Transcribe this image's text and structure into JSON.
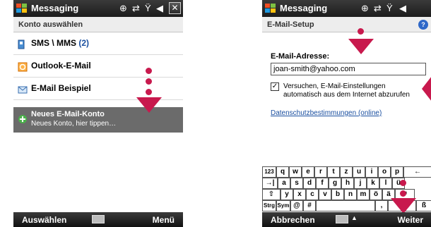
{
  "left": {
    "title": "Messaging",
    "subheader": "Konto auswählen",
    "accounts": [
      {
        "label": "SMS \\ MMS",
        "count": "(2)",
        "icon": "sms-icon"
      },
      {
        "label": "Outlook-E-Mail",
        "icon": "outlook-icon"
      },
      {
        "label": "E-Mail Beispiel",
        "icon": "email-icon"
      },
      {
        "label": "Neues E-Mail-Konto",
        "sub": "Neues Konto, hier tippen…",
        "icon": "new-account-icon"
      }
    ],
    "softkeys": {
      "left": "Auswählen",
      "right": "Menü"
    }
  },
  "right": {
    "title": "Messaging",
    "subheader": "E-Mail-Setup",
    "email_label": "E-Mail-Adresse:",
    "email_value": "joan-smith@yahoo.com",
    "checkbox_checked": true,
    "checkbox_text_line1": "Versuchen, E-Mail-Einstellungen",
    "checkbox_text_line2": "automatisch aus dem Internet abzurufen",
    "privacy_link": "Datenschutzbestimmungen (online)",
    "softkeys": {
      "left": "Abbrechen",
      "right": "Weiter"
    },
    "keyboard": {
      "row1": [
        "123",
        "q",
        "w",
        "e",
        "r",
        "t",
        "z",
        "u",
        "i",
        "o",
        "p",
        "←"
      ],
      "row2": [
        "→|",
        "a",
        "s",
        "d",
        "f",
        "g",
        "h",
        "j",
        "k",
        "l",
        "ü"
      ],
      "row3": [
        "⇧",
        "y",
        "x",
        "c",
        "v",
        "b",
        "n",
        "m",
        "ö",
        "ä",
        "↵"
      ],
      "row4": [
        "Strg",
        "Sym",
        "@",
        "#",
        ",",
        "ß"
      ]
    }
  },
  "colors": {
    "accent": "#c8194d",
    "selection": "#6b6b6b",
    "titlebar": "#1c1c1c",
    "link": "#1a4fa0"
  }
}
